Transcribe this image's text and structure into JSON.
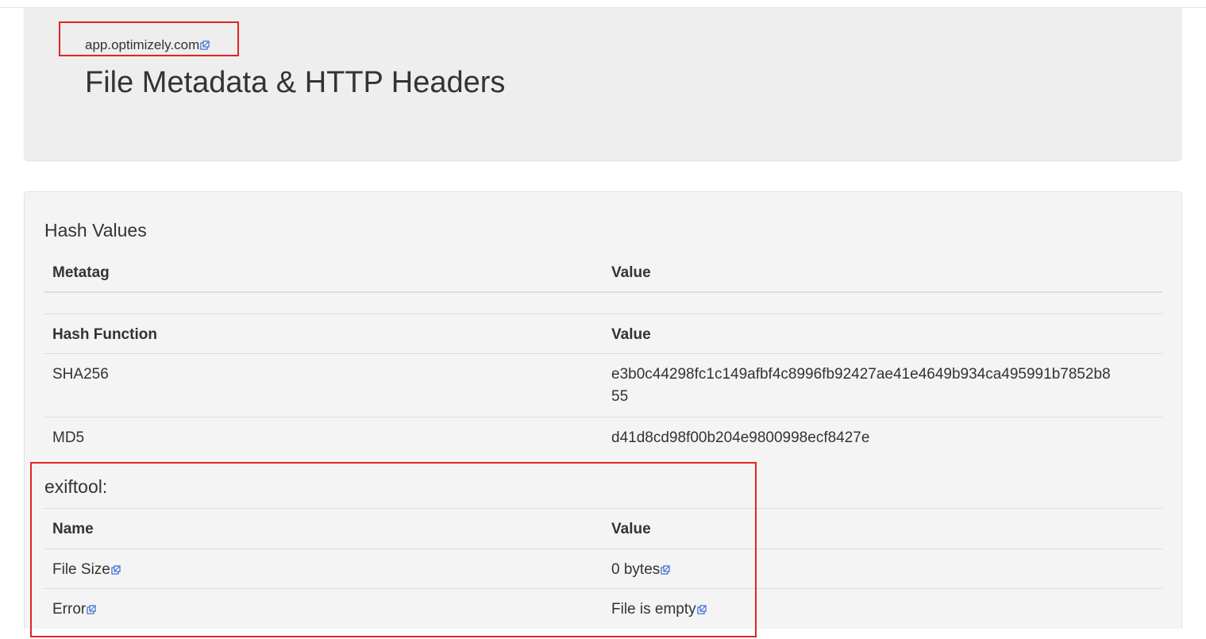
{
  "header": {
    "site_link": "app.optimizely.com",
    "title": "File Metadata & HTTP Headers"
  },
  "hash_values": {
    "title": "Hash Values",
    "meta_table": {
      "col1": "Metatag",
      "col2": "Value"
    },
    "hash_table": {
      "col1": "Hash Function",
      "col2": "Value",
      "rows": [
        {
          "name": "SHA256",
          "value_line1": "e3b0c44298fc1c149afbf4c8996fb92427ae41e4649b934ca495991b7852b8",
          "value_line2": "55"
        },
        {
          "name": "MD5",
          "value": "d41d8cd98f00b204e9800998ecf8427e"
        }
      ]
    }
  },
  "exiftool": {
    "title": "exiftool:",
    "col1": "Name",
    "col2": "Value",
    "rows": [
      {
        "name": "File Size",
        "value": "0 bytes"
      },
      {
        "name": "Error",
        "value": "File is empty"
      }
    ]
  },
  "icons": {
    "external_link": "external-link-icon"
  },
  "colors": {
    "highlight_border": "#e02424",
    "icon_blue": "#3366cc"
  }
}
